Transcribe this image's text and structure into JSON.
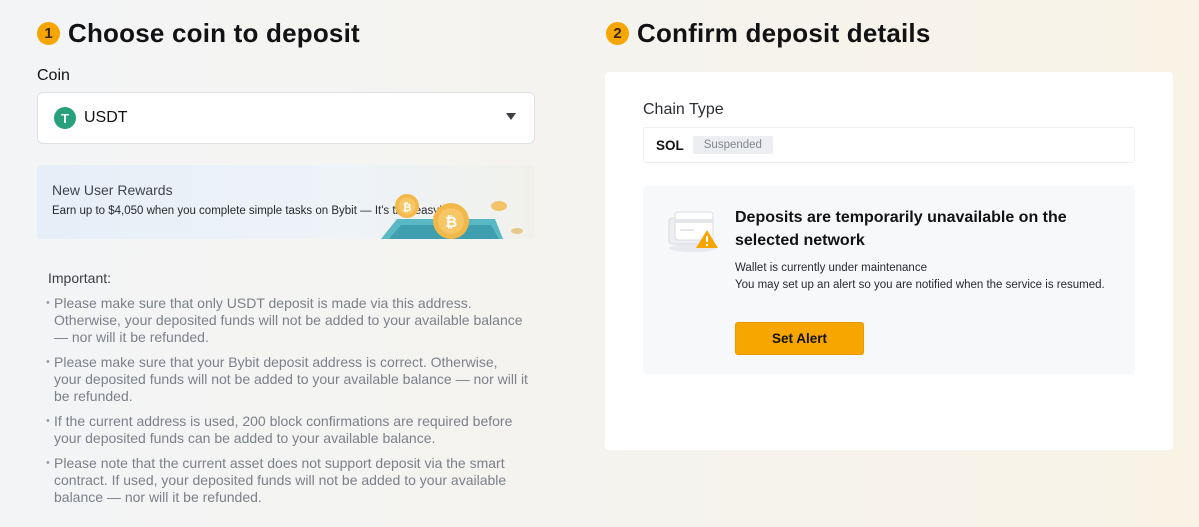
{
  "step1": {
    "number": "1",
    "title": "Choose coin to deposit"
  },
  "coin": {
    "label": "Coin",
    "selected": "USDT",
    "icon": "tether-icon",
    "icon_glyph": "T",
    "icon_color": "#26a17b"
  },
  "rewards": {
    "title": "New User Rewards",
    "description": "Earn up to $4,050 when you complete simple tasks on Bybit — It's that easy!",
    "art_icon": "wallet-bitcoin-icon"
  },
  "important": {
    "title": "Important:",
    "notes": [
      "Please make sure that only USDT deposit is made via this address. Otherwise, your deposited funds will not be added to your available balance — nor will it be refunded.",
      "Please make sure that your Bybit deposit address is correct. Otherwise, your deposited funds will not be added to your available balance — nor will it be refunded.",
      "If the current address is used, 200 block confirmations are required before your deposited funds can be added to your available balance.",
      "Please note that the current asset does not support deposit via the smart contract. If used, your deposited funds will not be added to your available balance — nor will it be refunded."
    ]
  },
  "step2": {
    "number": "2",
    "title": "Confirm deposit details"
  },
  "chain": {
    "label": "Chain Type",
    "name": "SOL",
    "status": "Suspended"
  },
  "unavailable": {
    "icon": "maintenance-warning-icon",
    "title": "Deposits are temporarily unavailable on the selected network",
    "line1": "Wallet is currently under maintenance",
    "line2": "You may set up an alert so you are notified when the service is resumed.",
    "button": "Set Alert"
  },
  "colors": {
    "accent": "#f7a600",
    "tether": "#26a17b"
  }
}
